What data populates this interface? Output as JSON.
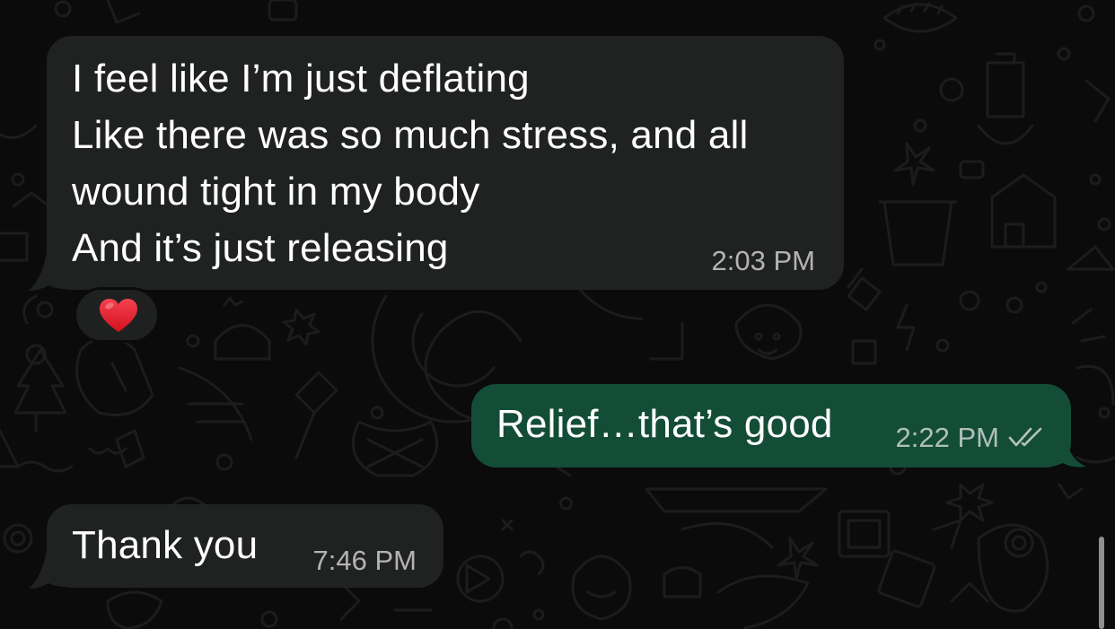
{
  "conversation": {
    "messages": [
      {
        "direction": "incoming",
        "lines": [
          "I feel like I’m just deflating",
          "Like there was so much stress, and all",
          "wound tight in my body",
          "And it’s just releasing"
        ],
        "time": "2:03 PM",
        "reaction": "red-heart"
      },
      {
        "direction": "outgoing",
        "text": "Relief…that’s good",
        "time": "2:22 PM",
        "status": "read-double-check-icon"
      },
      {
        "direction": "incoming",
        "text": "Thank you",
        "time": "7:46 PM"
      }
    ]
  },
  "theme": {
    "background": "#0b0b0b",
    "incoming_bubble": "#202222",
    "outgoing_bubble": "#144d37",
    "doodle_stroke": "#1d1d1d",
    "heart": "#e21b2c"
  }
}
